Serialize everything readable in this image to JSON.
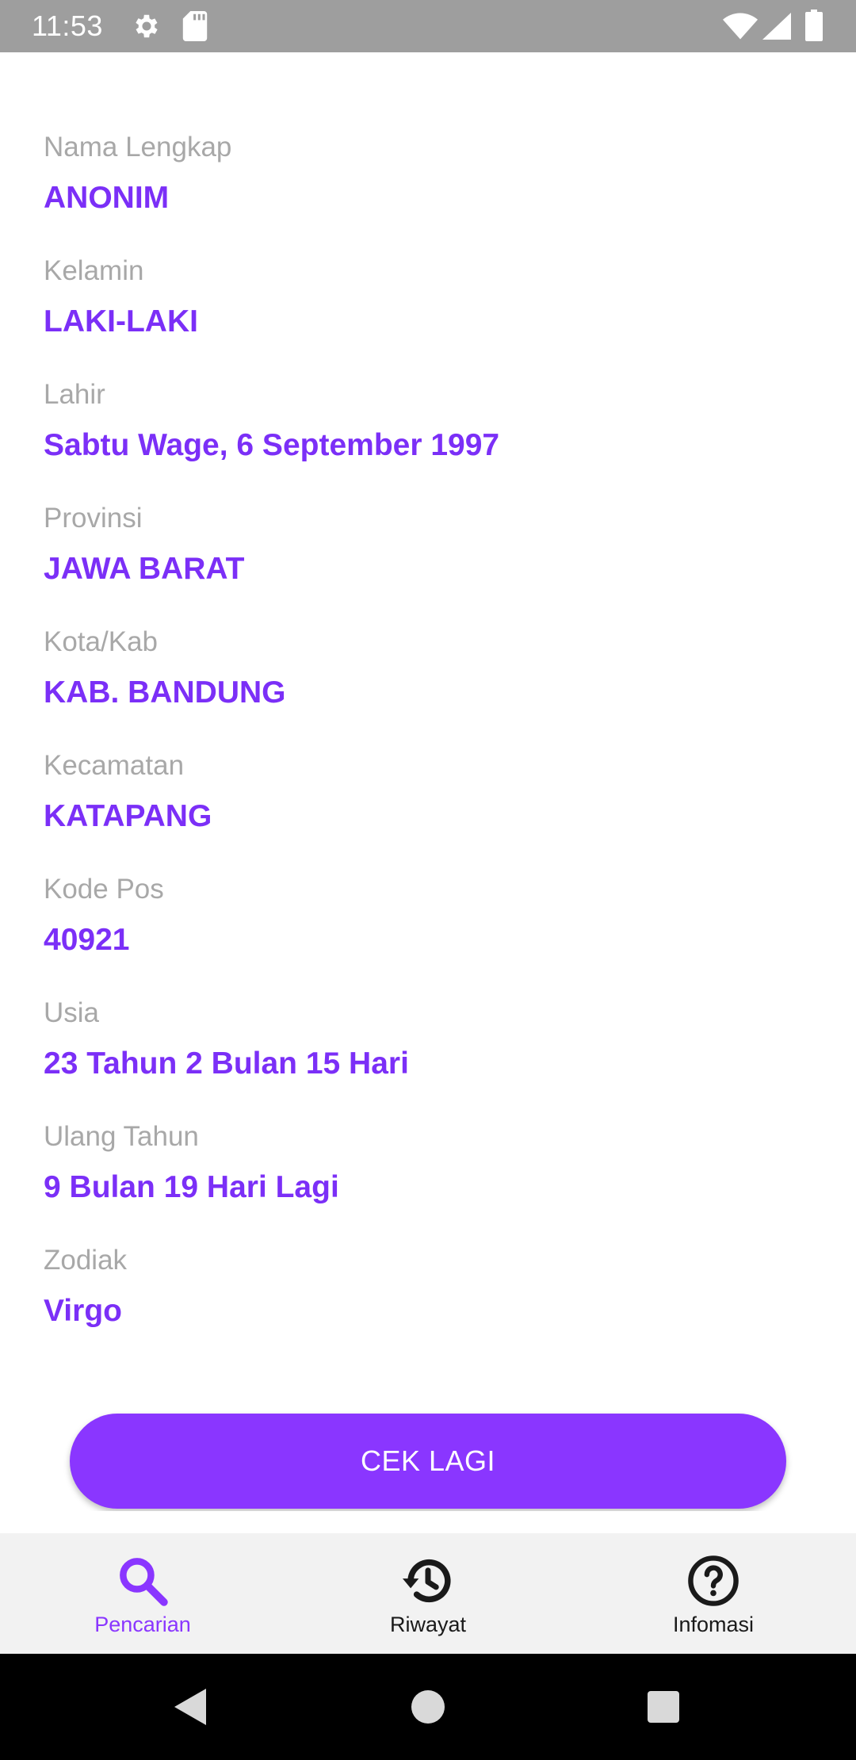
{
  "status_bar": {
    "time": "11:53",
    "icons": [
      "gear-icon",
      "sd-card-icon",
      "wifi-icon",
      "signal-icon",
      "battery-icon"
    ]
  },
  "fields": [
    {
      "label": "Nama Lengkap",
      "value": "ANONIM"
    },
    {
      "label": "Kelamin",
      "value": "LAKI-LAKI"
    },
    {
      "label": "Lahir",
      "value": "Sabtu Wage, 6 September 1997"
    },
    {
      "label": "Provinsi",
      "value": "JAWA BARAT"
    },
    {
      "label": "Kota/Kab",
      "value": "KAB. BANDUNG"
    },
    {
      "label": "Kecamatan",
      "value": "KATAPANG"
    },
    {
      "label": "Kode Pos",
      "value": "40921"
    },
    {
      "label": "Usia",
      "value": "23 Tahun 2 Bulan 15 Hari"
    },
    {
      "label": "Ulang Tahun",
      "value": "9 Bulan 19 Hari Lagi"
    },
    {
      "label": "Zodiak",
      "value": "Virgo"
    }
  ],
  "actions": {
    "check_again_label": "CEK LAGI"
  },
  "bottom_nav": {
    "items": [
      {
        "label": "Pencarian",
        "icon": "search-icon",
        "active": true
      },
      {
        "label": "Riwayat",
        "icon": "history-icon",
        "active": false
      },
      {
        "label": "Infomasi",
        "icon": "help-circle-icon",
        "active": false
      }
    ]
  },
  "colors": {
    "accent": "#8a36ff",
    "value_text": "#7b2ff7",
    "label_text": "#a8a8a8",
    "status_bar": "#9e9e9e",
    "nav_background": "#f2f2f2"
  }
}
